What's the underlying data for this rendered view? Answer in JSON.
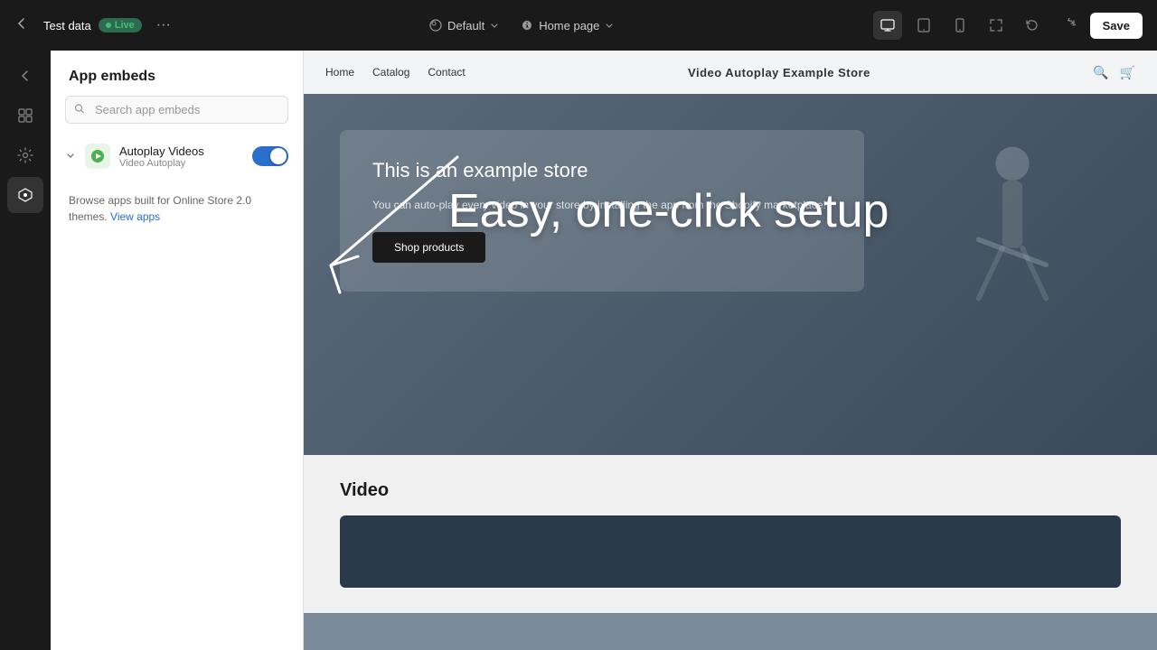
{
  "topbar": {
    "back_icon": "←",
    "store_name": "Test data",
    "live_label": "Live",
    "more_icon": "···",
    "default_label": "Default",
    "page_label": "Home page",
    "save_label": "Save"
  },
  "icon_sidebar": {
    "items": [
      {
        "name": "back-nav-icon",
        "icon": "←"
      },
      {
        "name": "sections-icon",
        "icon": "⊞"
      },
      {
        "name": "settings-icon",
        "icon": "⚙"
      },
      {
        "name": "apps-icon",
        "icon": "⬡",
        "active": true
      }
    ]
  },
  "panel": {
    "title": "App embeds",
    "search_placeholder": "Search app embeds",
    "app_item": {
      "title": "Autoplay Videos",
      "subtitle": "Video Autoplay",
      "toggle_on": true
    },
    "footer_text": "Browse apps built for Online Store 2.0 themes. ",
    "footer_link": "View apps"
  },
  "store_preview": {
    "nav": {
      "links": [
        "Home",
        "Catalog",
        "Contact"
      ],
      "title": "Video Autoplay Example Store"
    },
    "hero": {
      "card_title": "This is an example store",
      "card_desc": "You can auto-play every video in your store by installing the app from the Shopify marketplace!",
      "card_btn": "Shop products"
    },
    "overlay_text": "Easy, one-click setup",
    "video_section": {
      "title": "Video"
    }
  }
}
